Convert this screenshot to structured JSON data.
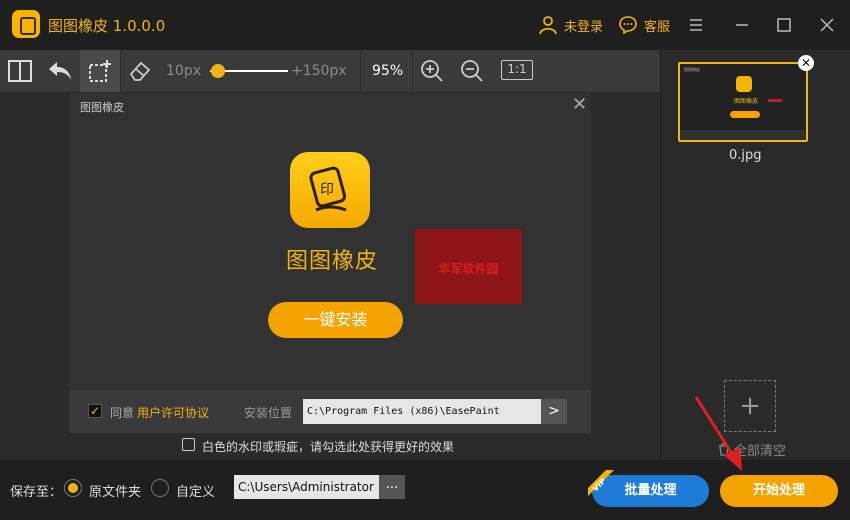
{
  "app": {
    "title": "图图橡皮  1.0.0.0"
  },
  "header": {
    "login_label": "未登录",
    "service_label": "客服"
  },
  "toolbar": {
    "brush_min": "10px",
    "brush_max": "+150px",
    "zoom": "95%",
    "actual_size": "1:1",
    "brush_slider_value": 0.1
  },
  "image": {
    "window_title": "图图橡皮",
    "product_name": "图图橡皮",
    "logo_char": "印",
    "install_button": "一键安装",
    "watermark_text": "华军软件园",
    "agree_label": "同意",
    "license_link": "用户许可协议",
    "install_location_label": "安装位置",
    "install_path": "C:\\Program Files (x86)\\EasePaint",
    "path_button": ">"
  },
  "options": {
    "white_watermark_hint": "白色的水印或瑕疵，请勾选此处获得更好的效果"
  },
  "files": {
    "thumbnail_name": "0.jpg",
    "clear_all": "全部清空"
  },
  "bottom": {
    "save_to_label": "保存至：",
    "original_folder": "原文件夹",
    "custom": "自定义",
    "output_path": "C:\\Users\\Administrator",
    "browse": "...",
    "batch_button": "批量处理",
    "vip_badge": "VIP",
    "start_button": "开始处理"
  },
  "colors": {
    "accent": "#f3b316",
    "blue": "#1f7bd8",
    "watermark": "#8e1518"
  }
}
